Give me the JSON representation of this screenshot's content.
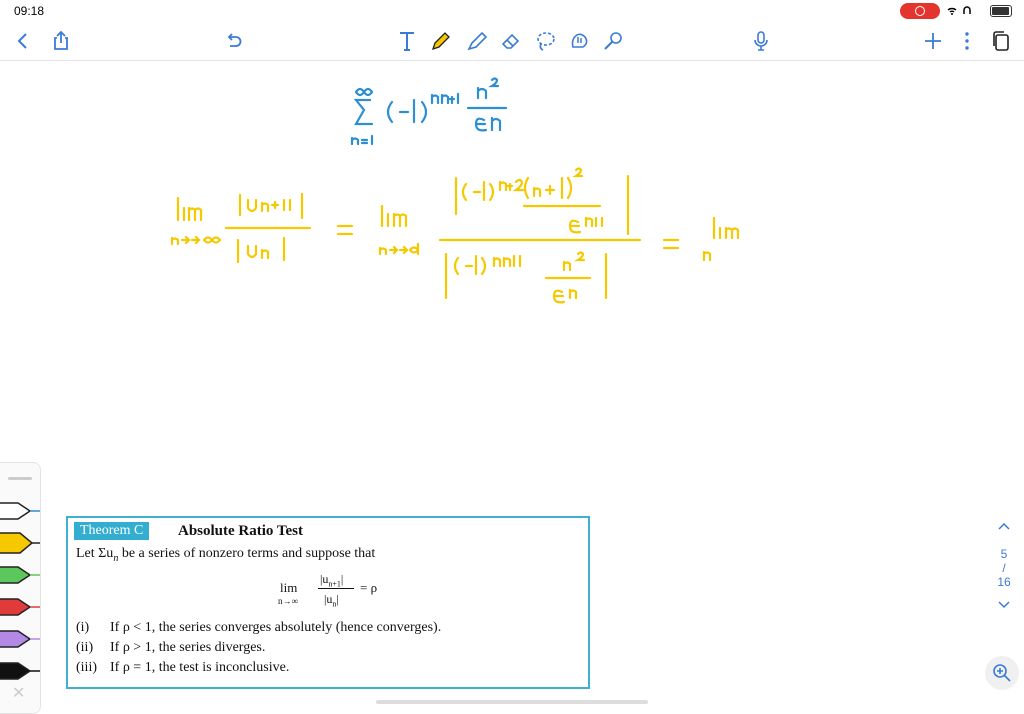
{
  "status": {
    "time": "09:18"
  },
  "toolbar": {
    "icons": [
      "back-icon",
      "share-icon",
      "undo-icon",
      "text-tool-icon",
      "pen-tool-icon",
      "highlighter-tool-icon",
      "eraser-tool-icon",
      "lasso-tool-icon",
      "shape-tool-icon",
      "laser-tool-icon",
      "mic-icon",
      "add-page-icon",
      "more-icon",
      "pages-icon"
    ]
  },
  "colors": {
    "accent": "#3a7bd5",
    "ink_blue": "#2d8fd0",
    "ink_yellow": "#f5c800",
    "theorem_border": "#3fb0d0"
  },
  "theorem": {
    "tag": "Theorem C",
    "title": "Absolute Ratio Test",
    "intro": "Let Σu",
    "intro_sub": "n",
    "intro_rest": " be a series of nonzero terms and suppose that",
    "lim": "lim",
    "lim_sub": "n→∞",
    "numerator": "|u",
    "numerator_sub": "n+1",
    "numerator_end": "|",
    "denominator": "|u",
    "denominator_sub": "n",
    "denominator_end": "|",
    "equals": "= ρ",
    "items": [
      {
        "label": "(i)",
        "text": "If ρ < 1, the series converges absolutely (hence converges)."
      },
      {
        "label": "(ii)",
        "text": "If ρ > 1, the series diverges."
      },
      {
        "label": "(iii)",
        "text": "If ρ = 1, the test is inconclusive."
      }
    ]
  },
  "pager": {
    "current": "5",
    "sep": "/",
    "total": "16"
  }
}
